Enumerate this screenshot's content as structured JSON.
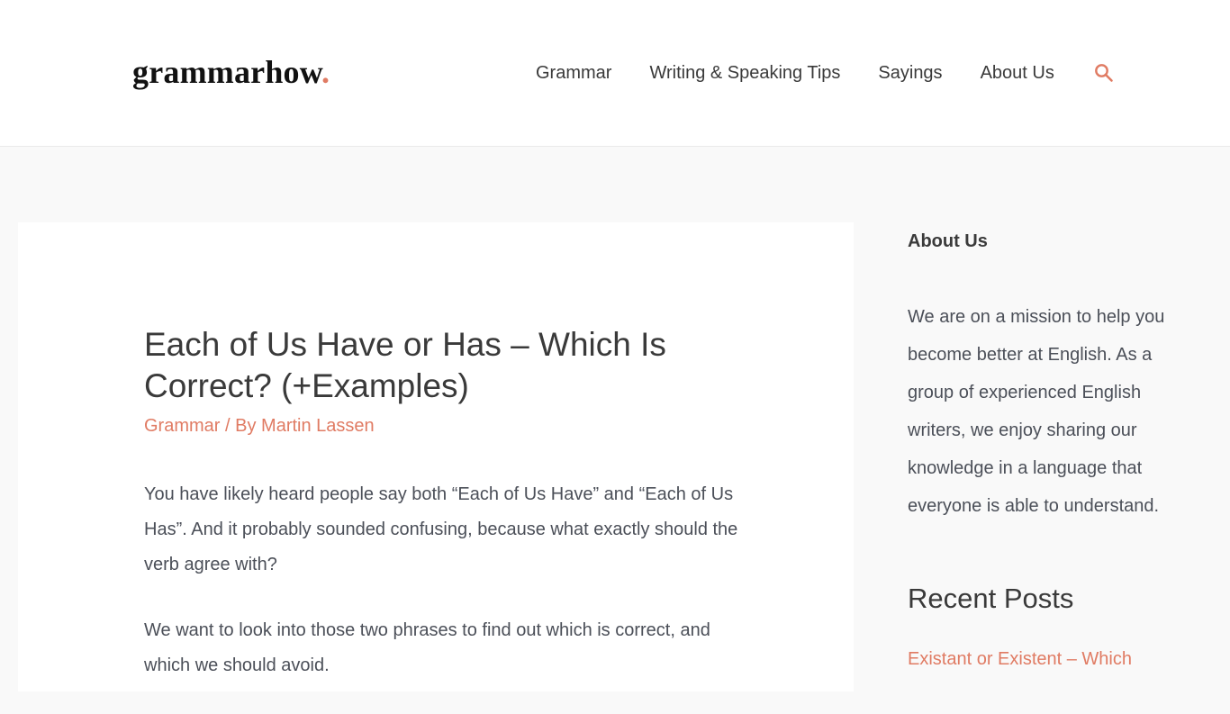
{
  "header": {
    "logo_text": "grammarhow",
    "logo_dot": ".",
    "nav": [
      {
        "label": "Grammar"
      },
      {
        "label": "Writing & Speaking Tips"
      },
      {
        "label": "Sayings"
      },
      {
        "label": "About Us"
      }
    ],
    "search_icon": "search-icon"
  },
  "article": {
    "title": "Each of Us Have or Has – Which Is Correct? (+Examples)",
    "category": "Grammar",
    "meta_separator": " / By ",
    "author": "Martin Lassen",
    "paragraphs": [
      "You have likely heard people say both “Each of Us Have” and “Each of Us Has”. And it probably sounded confusing, because what exactly should the verb agree with?",
      "We want to look into those two phrases to find out which is correct, and which we should avoid."
    ]
  },
  "sidebar": {
    "about_title": "About Us",
    "about_text": "We are on a mission to help you become better at English. As a group of experienced English writers, we enjoy sharing our knowledge in a language that everyone is able to understand.",
    "recent_posts_title": "Recent Posts",
    "recent_posts": [
      {
        "label": "Existant or Existent – Which"
      }
    ]
  },
  "colors": {
    "accent": "#e07b63",
    "text": "#3a3a3a",
    "body_text": "#4b4f58",
    "page_bg": "#f9f9f9",
    "card_bg": "#ffffff"
  }
}
